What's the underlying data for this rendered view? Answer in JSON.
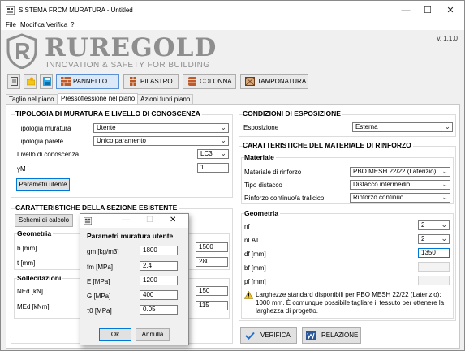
{
  "window": {
    "title": "SISTEMA FRCM MURATURA - Untitled",
    "minimize": "—",
    "maximize": "☐",
    "close": "✕"
  },
  "menu": [
    "File",
    "Modifica",
    "Verifica",
    "?"
  ],
  "header": {
    "logo": "RUREGOLD",
    "tagline": "INNOVATION & SAFETY FOR BUILDING",
    "version": "v. 1.1.0",
    "colors": {
      "logo_gray": "#8e8e8e",
      "accent_blue": "#0078d7"
    }
  },
  "toolbar": {
    "pannello": "PANNELLO",
    "pilastro": "PILASTRO",
    "colonna": "COLONNA",
    "tamponatura": "TAMPONATURA"
  },
  "tabs": [
    "Taglio nel piano",
    "Pressoflessione nel piano",
    "Azioni fuori piano"
  ],
  "masonry": {
    "title": "TIPOLOGIA DI MURATURA E LIVELLO DI CONOSCENZA",
    "tipologia_label": "Tipologia muratura",
    "tipologia_value": "Utente",
    "parete_label": "Tipologia parete",
    "parete_value": "Unico paramento",
    "livello_label": "Livello di conoscenza",
    "livello_value": "LC3",
    "gamma_label": "γM",
    "gamma_value": "1",
    "param_button": "Parametri utente"
  },
  "section": {
    "title": "CARATTERISTICHE DELLA SEZIONE ESISTENTE",
    "schemi_button": "Schemi di calcolo",
    "geometria": "Geometria",
    "b_label": "b [mm]",
    "b_value": "1500",
    "t_label": "t [mm]",
    "t_value": "280",
    "sollecitazioni": "Sollecitazioni",
    "ned_label": "NEd [kN]",
    "ned_value": "150",
    "med_label": "MEd [kNm]",
    "med_value": "115"
  },
  "dialog": {
    "title": "Parametri muratura utente",
    "minimize": "—",
    "maximize": "☐",
    "close": "✕",
    "fields": [
      {
        "label": "gm [kg/m3]",
        "value": "1800"
      },
      {
        "label": "fm [MPa]",
        "value": "2.4"
      },
      {
        "label": "E [MPa]",
        "value": "1200"
      },
      {
        "label": "G [MPa]",
        "value": "400"
      },
      {
        "label": "τ0 [MPa]",
        "value": "0.05"
      }
    ],
    "ok": "Ok",
    "cancel": "Annulla"
  },
  "exposure": {
    "title": "CONDIZIONI DI ESPOSIZIONE",
    "label": "Esposizione",
    "value": "Esterna"
  },
  "reinforcement": {
    "title": "CARATTERISTICHE DEL MATERIALE DI RINFORZO",
    "materiale": "Materiale",
    "mat_label": "Materiale di rinforzo",
    "mat_value": "PBO MESH 22/22 (Laterizio)",
    "distacco_label": "Tipo distacco",
    "distacco_value": "Distacco intermedio",
    "rinforzo_label": "Rinforzo continuo/a tralicico",
    "rinforzo_value": "Rinforzo continuo",
    "geometria": "Geometria",
    "nf_label": "nf",
    "nf_value": "2",
    "nlati_label": "nLATI",
    "nlati_value": "2",
    "df_label": "df [mm]",
    "df_value": "1350",
    "bf_label": "bf [mm]",
    "pf_label": "pf [mm]",
    "note": "Larghezze standard disponibili per PBO MESH 22/22 (Laterizio): 1000 mm. È comunque possibile tagliare il tessuto per ottenere la larghezza di progetto."
  },
  "actions": {
    "verifica": "VERIFICA",
    "relazione": "RELAZIONE"
  }
}
